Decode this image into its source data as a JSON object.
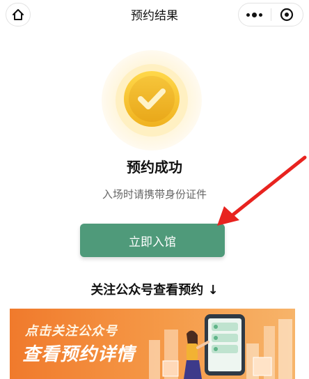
{
  "header": {
    "title": "预约结果",
    "home_icon": "home-icon",
    "more_icon": "more-icon",
    "close_icon": "target-icon"
  },
  "result": {
    "status": "预约成功",
    "hint": "入场时请携带身份证件",
    "icon": "check-icon",
    "icon_color": "#f2c233"
  },
  "actions": {
    "enter_label": "立即入馆",
    "enter_color": "#4f9a7a"
  },
  "follow": {
    "text": "关注公众号查看预约 ↓"
  },
  "banner": {
    "line1": "点击关注公众号",
    "line2": "查看预约详情",
    "bg_color": "#f07a2c"
  },
  "annotation": {
    "arrow_color": "#e8231f"
  }
}
